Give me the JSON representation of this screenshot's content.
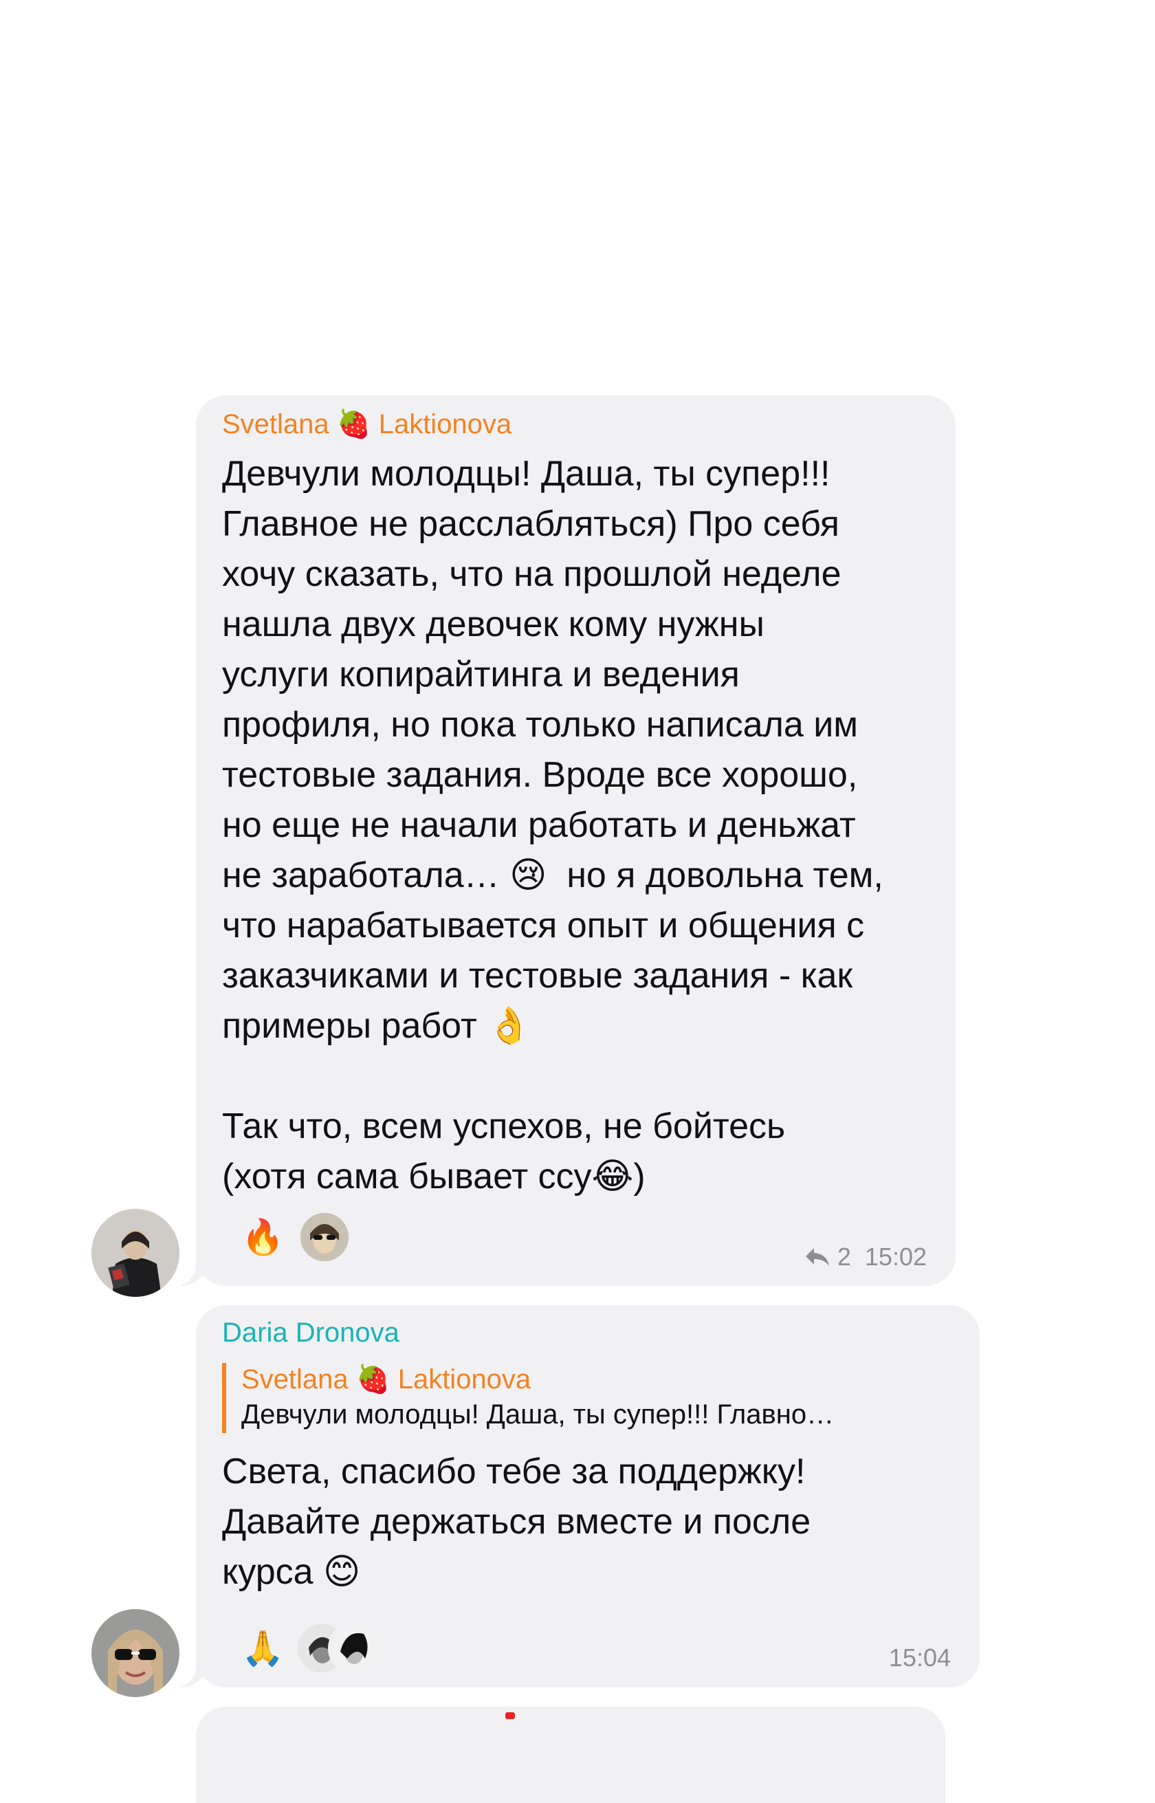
{
  "messages": [
    {
      "sender": "Svetlana 🍓 Laktionova",
      "sender_color": "#f5821f",
      "text": "Девчули молодцы! Даша, ты супер!!!\nГлавное не расслабляться) Про себя\nхочу сказать, что на прошлой неделе\nнашла двух девочек кому нужны\nуслуги копирайтинга и ведения\nпрофиля, но пока только написала им\nтестовые задания. Вроде все хорошо,\nно еще не начали работать и деньжат\nне заработала… 😢  но я довольна тем,\nчто нарабатывается опыт и общения с\nзаказчиками и тестовые задания - как\nпримеры работ 👌\n\nТак что, всем успехов, не бойтесь\n(хотя сама бывает ссу😂)",
      "reaction_emoji": "🔥",
      "reply_count": "2",
      "time": "15:02"
    },
    {
      "sender": "Daria Dronova",
      "sender_color": "#1ab3b8",
      "quote_sender": "Svetlana 🍓 Laktionova",
      "quote_text": "Девчули молодцы! Даша, ты супер!!! Главно…",
      "text": "Света, спасибо тебе за поддержку!\nДавайте держаться вместе и после\nкурса 😊",
      "reaction_emoji": "🙏",
      "time": "15:04"
    }
  ],
  "icons": {
    "reply": "reply-arrow-icon"
  },
  "colors": {
    "bubble": "#f1f1f4",
    "meta": "#8e8e93"
  }
}
